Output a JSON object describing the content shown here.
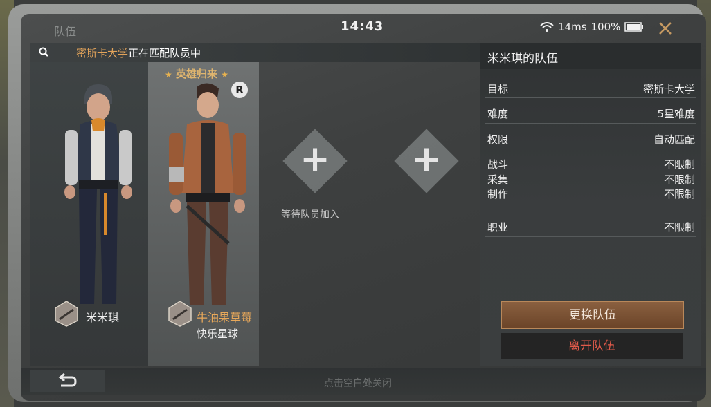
{
  "window": {
    "title": "队伍",
    "time": "14:43",
    "ping": "14ms",
    "battery": "100%"
  },
  "search": {
    "prefix": "密斯卡大学",
    "suffix": "正在匹配队员中"
  },
  "members": [
    {
      "name": "米米琪",
      "hero_tag": "",
      "subtitle": ""
    },
    {
      "name": "牛油果草莓",
      "hero_tag": "英雄归来",
      "subtitle": "快乐星球"
    }
  ],
  "empty_slots": {
    "waiting_text": "等待队员加入"
  },
  "team_panel": {
    "title": "米米琪的队伍",
    "rows": [
      {
        "label": "目标",
        "value": "密斯卡大学"
      },
      {
        "label": "难度",
        "value": "5星难度"
      },
      {
        "label": "权限",
        "value": "自动匹配"
      },
      {
        "label": "战斗",
        "value": "不限制"
      },
      {
        "label": "采集",
        "value": "不限制"
      },
      {
        "label": "制作",
        "value": "不限制"
      },
      {
        "label": "职业",
        "value": "不限制"
      }
    ],
    "change_button": "更换队伍",
    "leave_button": "离开队伍"
  },
  "footer": {
    "hint": "点击空白处关闭"
  },
  "icons": {
    "close": "close-icon",
    "search": "search-icon",
    "back": "back-arrow-icon",
    "wifi": "wifi-icon",
    "battery": "battery-icon"
  },
  "colors": {
    "accent": "#e2a35a",
    "leave": "#e05a4a",
    "change_bg": "#7a5234"
  }
}
